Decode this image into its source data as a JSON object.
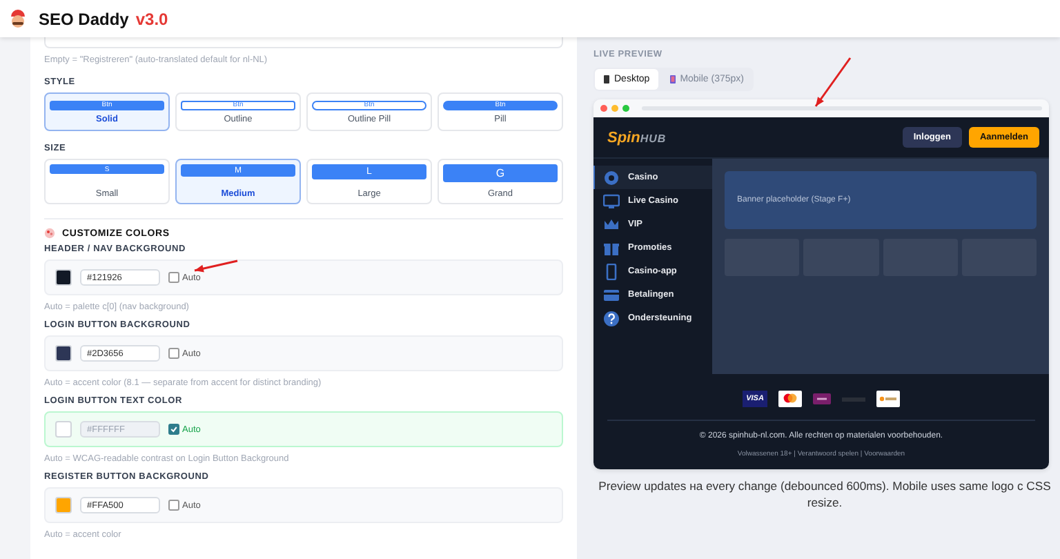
{
  "app": {
    "title": "SEO Daddy",
    "version": "v3.0"
  },
  "register_hint": "Empty = \"Registreren\" (auto-translated default for nl-NL)",
  "style": {
    "label": "STYLE",
    "options": [
      {
        "label": "Solid",
        "sample": "Btn",
        "kind": "solid",
        "selected": true
      },
      {
        "label": "Outline",
        "sample": "Btn",
        "kind": "outline",
        "selected": false
      },
      {
        "label": "Outline Pill",
        "sample": "Btn",
        "kind": "outline-pill",
        "selected": false
      },
      {
        "label": "Pill",
        "sample": "Btn",
        "kind": "pill",
        "selected": false
      }
    ]
  },
  "size": {
    "label": "SIZE",
    "options": [
      {
        "label": "Small",
        "sample": "S",
        "kind": "small",
        "selected": false
      },
      {
        "label": "Medium",
        "sample": "M",
        "kind": "medium",
        "selected": true
      },
      {
        "label": "Large",
        "sample": "L",
        "kind": "large",
        "selected": false
      },
      {
        "label": "Grand",
        "sample": "G",
        "kind": "grand",
        "selected": false
      }
    ]
  },
  "colors": {
    "title": "CUSTOMIZE COLORS",
    "fields": [
      {
        "label": "HEADER / NAV BACKGROUND",
        "color": "#121926",
        "value": "#121926",
        "auto_label": "Auto",
        "auto": false,
        "hint": "Auto = palette c[0] (nav background)"
      },
      {
        "label": "LOGIN BUTTON BACKGROUND",
        "color": "#2d3656",
        "value": "#2D3656",
        "auto_label": "Auto",
        "auto": false,
        "hint": "Auto = accent color (8.1 — separate from accent for distinct branding)"
      },
      {
        "label": "LOGIN BUTTON TEXT COLOR",
        "color": "#ffffff",
        "value": "#FFFFFF",
        "auto_label": "Auto",
        "auto": true,
        "hint": "Auto = WCAG-readable contrast on Login Button Background"
      },
      {
        "label": "REGISTER BUTTON BACKGROUND",
        "color": "#ffa500",
        "value": "#FFA500",
        "auto_label": "Auto",
        "auto": false,
        "hint": "Auto = accent color"
      }
    ]
  },
  "preview": {
    "title": "LIVE PREVIEW",
    "tabs": [
      {
        "label": "Desktop",
        "selected": true
      },
      {
        "label": "Mobile (375px)",
        "selected": false
      }
    ],
    "site": {
      "logo_first": "Spin",
      "logo_second": "HUB",
      "login": "Inloggen",
      "register": "Aanmelden",
      "nav": [
        {
          "label": "Casino",
          "kind": "casino",
          "selected": true
        },
        {
          "label": "Live Casino",
          "kind": "live",
          "selected": false
        },
        {
          "label": "VIP",
          "kind": "vip",
          "selected": false
        },
        {
          "label": "Promoties",
          "kind": "promo",
          "selected": false
        },
        {
          "label": "Casino-app",
          "kind": "app",
          "selected": false
        },
        {
          "label": "Betalingen",
          "kind": "pay",
          "selected": false
        },
        {
          "label": "Ondersteuning",
          "kind": "help",
          "selected": false
        }
      ],
      "banner": "Banner placeholder (Stage F+)",
      "visa": "VISA",
      "copyright": "© 2026 spinhub-nl.com. Alle rechten op materialen voorbehouden.",
      "footer_links": "Volwassenen 18+ | Verantwoord spelen | Voorwaarden"
    },
    "note": "Preview updates на every change (debounced 600ms). Mobile uses same logo с CSS resize."
  }
}
